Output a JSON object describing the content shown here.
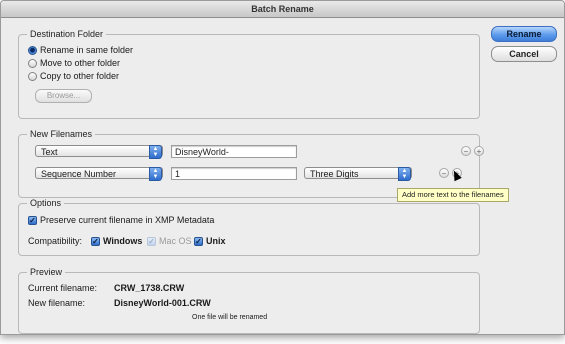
{
  "window": {
    "title": "Batch Rename"
  },
  "buttons": {
    "rename": "Rename",
    "cancel": "Cancel"
  },
  "destination": {
    "legend": "Destination Folder",
    "options": [
      {
        "label": "Rename in same folder",
        "selected": true
      },
      {
        "label": "Move to other folder",
        "selected": false
      },
      {
        "label": "Copy to other folder",
        "selected": false
      }
    ],
    "browse_label": "Browse..."
  },
  "new_filenames": {
    "legend": "New Filenames",
    "rows": [
      {
        "type": "Text",
        "value": "DisneyWorld-"
      },
      {
        "type": "Sequence Number",
        "value": "1",
        "digits": "Three Digits"
      }
    ],
    "tooltip": "Add more text to the filenames"
  },
  "options": {
    "legend": "Options",
    "preserve_label": "Preserve current filename in XMP Metadata",
    "compat_label": "Compatibility:",
    "windows_label": "Windows",
    "macos_label": "Mac OS",
    "unix_label": "Unix"
  },
  "preview": {
    "legend": "Preview",
    "current_label": "Current filename:",
    "current_value": "CRW_1738.CRW",
    "new_label": "New filename:",
    "new_value": "DisneyWorld-001.CRW",
    "note": "One file will be renamed"
  },
  "colors": {
    "accent": "#3f7fd9",
    "tooltip_bg": "#ffffc6",
    "window_bg": "#ececec"
  }
}
